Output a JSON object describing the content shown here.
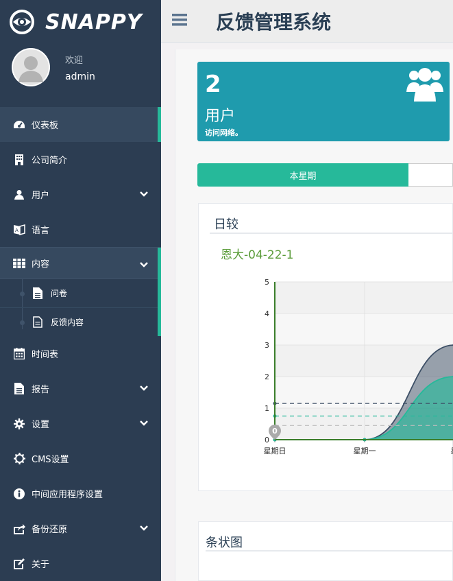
{
  "brand": {
    "logo_text": "SNAPPY"
  },
  "user": {
    "welcome": "欢迎",
    "name": "admin"
  },
  "sidebar": {
    "items": [
      {
        "label": "仪表板",
        "icon": "dashboard-icon"
      },
      {
        "label": "公司简介",
        "icon": "building-icon"
      },
      {
        "label": "用户",
        "icon": "user-icon"
      },
      {
        "label": "语言",
        "icon": "language-icon"
      },
      {
        "label": "内容",
        "icon": "grid-icon"
      },
      {
        "label": "时间表",
        "icon": "calendar-icon"
      },
      {
        "label": "报告",
        "icon": "file-icon"
      },
      {
        "label": "设置",
        "icon": "cog-icon"
      },
      {
        "label": "CMS设置",
        "icon": "gear-icon"
      },
      {
        "label": "中间应用程序设置",
        "icon": "info-icon"
      },
      {
        "label": "备份还原",
        "icon": "share-icon"
      },
      {
        "label": "关于",
        "icon": "edit-icon"
      }
    ],
    "content_sub": [
      {
        "label": "问卷",
        "icon": "document-icon"
      },
      {
        "label": "反馈内容",
        "icon": "document-outline-icon"
      }
    ]
  },
  "header": {
    "title": "反馈管理系统"
  },
  "stat_card": {
    "count": "2",
    "label": "用户",
    "sub": "访问网络。",
    "icon": "users-icon"
  },
  "tabs": {
    "active_label": "本星期"
  },
  "panel": {
    "title": "日较"
  },
  "chart_data": {
    "type": "area",
    "title": "恩大-04-22-1",
    "categories": [
      "星期日",
      "星期一",
      "星"
    ],
    "ylim": [
      0,
      5
    ],
    "yticks": [
      "0",
      "1",
      "2",
      "3",
      "4",
      "5"
    ],
    "grid": true,
    "series": [
      {
        "values": [
          0,
          0,
          3
        ],
        "color": "#3d4f66",
        "avg": 1.15
      },
      {
        "values": [
          0,
          0,
          2
        ],
        "color": "#26b99a",
        "avg": 0.75
      }
    ],
    "baseline_avg": 0.45,
    "marker_label": "0"
  },
  "panel2": {
    "title": "条状图"
  }
}
